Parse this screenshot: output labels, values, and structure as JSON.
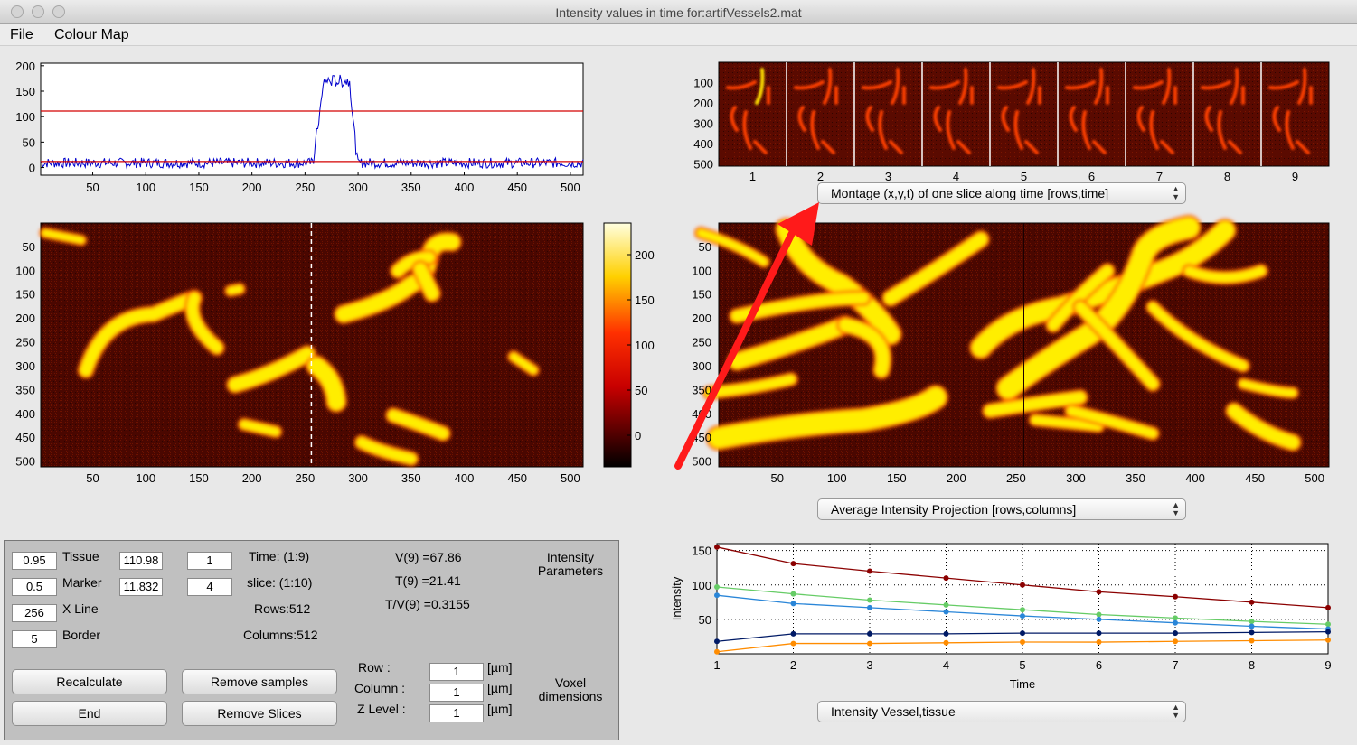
{
  "window": {
    "title": "Intensity values in time for:artifVessels2.mat"
  },
  "menu": [
    "File",
    "Colour Map"
  ],
  "profile_chart": {
    "type": "line",
    "xticks": [
      "50",
      "100",
      "150",
      "200",
      "250",
      "300",
      "350",
      "400",
      "450",
      "500"
    ],
    "yticks": [
      "200",
      "150",
      "100",
      "50",
      "0"
    ],
    "xlim": [
      1,
      512
    ],
    "ylim": [
      -15,
      205
    ],
    "thresholds": [
      110.98,
      11.832
    ],
    "x_line": 256
  },
  "image_left": {
    "xticks": [
      "50",
      "100",
      "150",
      "200",
      "250",
      "300",
      "350",
      "400",
      "450",
      "500"
    ],
    "yticks": [
      "50",
      "100",
      "150",
      "200",
      "250",
      "300",
      "350",
      "400",
      "450",
      "500"
    ],
    "marker_column": 256
  },
  "colorbar": {
    "ticks": [
      "200",
      "150",
      "100",
      "50",
      "0"
    ]
  },
  "montage": {
    "yticks": [
      "100",
      "200",
      "300",
      "400",
      "500"
    ],
    "xticks": [
      "1",
      "2",
      "3",
      "4",
      "5",
      "6",
      "7",
      "8",
      "9"
    ],
    "dropdown": "Montage (x,y,t) of one slice along time [rows,time]"
  },
  "projection": {
    "xticks": [
      "50",
      "100",
      "150",
      "200",
      "250",
      "300",
      "350",
      "400",
      "450",
      "500"
    ],
    "yticks": [
      "50",
      "100",
      "150",
      "200",
      "250",
      "300",
      "350",
      "400",
      "450",
      "500"
    ],
    "dropdown": "Average Intensity Projection [rows,columns]"
  },
  "chart_data": {
    "type": "line",
    "x": [
      1,
      2,
      3,
      4,
      5,
      6,
      7,
      8,
      9
    ],
    "xlabel": "Time",
    "ylabel": "Intensity",
    "xlim": [
      1,
      9
    ],
    "ylim": [
      0,
      160
    ],
    "yticks": [
      "150",
      "100",
      "50"
    ],
    "xticks": [
      "1",
      "2",
      "3",
      "4",
      "5",
      "6",
      "7",
      "8",
      "9"
    ],
    "grid": true,
    "series": [
      {
        "color": "#8b0000",
        "values": [
          155,
          131,
          120,
          110,
          100,
          90,
          83,
          75,
          67
        ]
      },
      {
        "color": "#66cc66",
        "values": [
          97,
          87,
          78,
          71,
          64,
          57,
          52,
          47,
          43
        ]
      },
      {
        "color": "#2a86d8",
        "values": [
          85,
          73,
          67,
          61,
          55,
          50,
          45,
          40,
          36
        ]
      },
      {
        "color": "#001a66",
        "values": [
          18,
          29,
          29,
          29,
          30,
          30,
          30,
          31,
          32
        ]
      },
      {
        "color": "#ff8c00",
        "values": [
          3,
          15,
          15,
          16,
          17,
          17,
          18,
          19,
          20
        ]
      }
    ]
  },
  "chart_dropdown": "Intensity Vessel,tissue",
  "controls": {
    "tissue_value": "0.95",
    "tissue_label": "Tissue",
    "tissue_threshold": "110.98",
    "marker_value": "0.5",
    "marker_label": "Marker",
    "marker_threshold": "11.832",
    "xline_value": "256",
    "xline_label": "X Line",
    "border_value": "5",
    "border_label": "Border",
    "time_value": "1",
    "time_label": "Time:  (1:9)",
    "slice_value": "4",
    "slice_label": "slice: (1:10)",
    "rows": "Rows:512",
    "columns": "Columns:512",
    "v9": "V(9) =67.86",
    "t9": "T(9) =21.41",
    "tv9": "T/V(9) =0.3155",
    "intensity_params": "Intensity Parameters",
    "recalculate": "Recalculate",
    "end": "End",
    "remove_samples": "Remove samples",
    "remove_slices": "Remove Slices",
    "row_label": "Row      :",
    "column_label": "Column  :",
    "zlevel_label": "Z Level :",
    "row_value": "1",
    "column_value": "1",
    "zlevel_value": "1",
    "unit": "[µm]",
    "voxel": "Voxel dimensions"
  },
  "colors": {
    "annotation_arrow": "#ff1a1a",
    "threshold_line": "#d40000",
    "signal": "#0000cc"
  }
}
